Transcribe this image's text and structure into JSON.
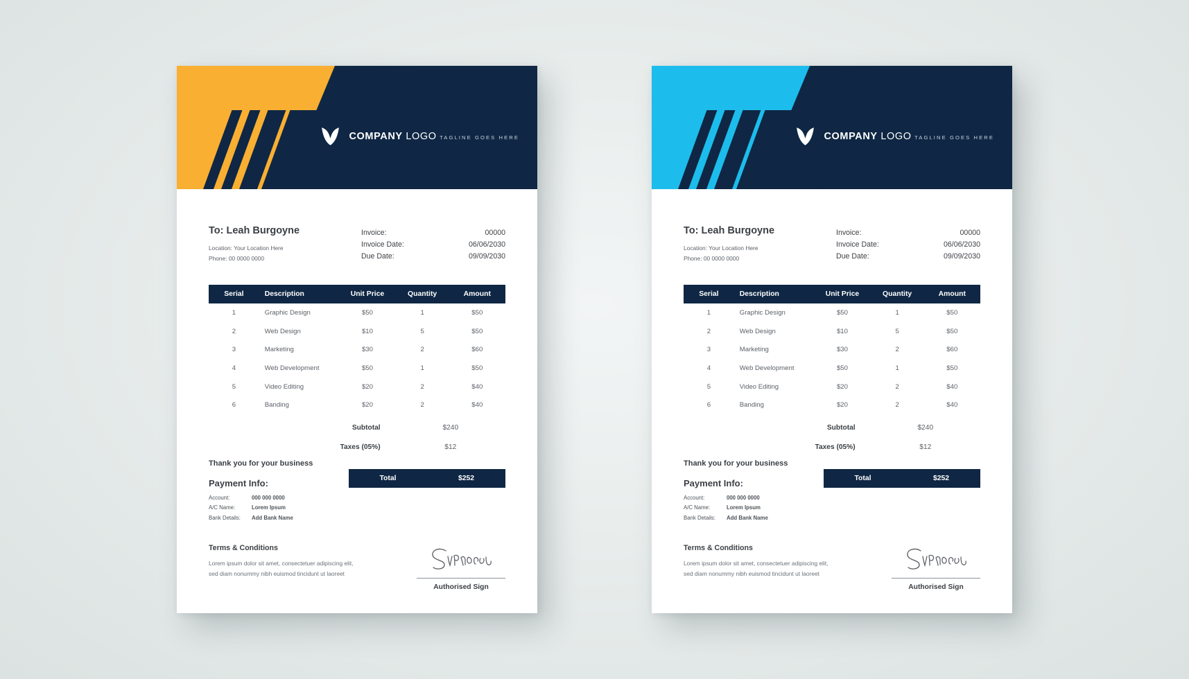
{
  "canvas": {
    "background": "#e8edec"
  },
  "cards": [
    {
      "id": "invoice-orange",
      "accent": "#F9AF32",
      "navy": "#0F2744",
      "logo": {
        "name_bold": "COMPANY",
        "name_light": "LOGO",
        "tagline": "TAGLINE GOES HERE",
        "mark": "butterfly-mark"
      },
      "bill_to": {
        "name": "To: Leah Burgoyne",
        "location": "Location: Your Location Here",
        "phone": "Phone: 00 0000 0000"
      },
      "meta": [
        {
          "label": "Invoice:",
          "value": "00000"
        },
        {
          "label": "Invoice Date:",
          "value": "06/06/2030"
        },
        {
          "label": "Due Date:",
          "value": "09/09/2030"
        }
      ],
      "table": {
        "columns": [
          "Serial",
          "Description",
          "Unit Price",
          "Quantity",
          "Amount"
        ],
        "rows": [
          [
            "1",
            "Graphic Design",
            "$50",
            "1",
            "$50"
          ],
          [
            "2",
            "Web Design",
            "$10",
            "5",
            "$50"
          ],
          [
            "3",
            "Marketing",
            "$30",
            "2",
            "$60"
          ],
          [
            "4",
            "Web Development",
            "$50",
            "1",
            "$50"
          ],
          [
            "5",
            "Video Editing",
            "$20",
            "2",
            "$40"
          ],
          [
            "6",
            "Banding",
            "$20",
            "2",
            "$40"
          ]
        ]
      },
      "summary": [
        {
          "label": "Subtotal",
          "value": "$240"
        },
        {
          "label": "Taxes (05%)",
          "value": "$12"
        }
      ],
      "total": {
        "label": "Total",
        "value": "$252"
      },
      "thanks": "Thank you for your business",
      "payment": {
        "title": "Payment Info:",
        "rows": [
          {
            "key": "Account:",
            "value": "000 000 0000"
          },
          {
            "key": "A/C Name:",
            "value": "Lorem Ipsum"
          },
          {
            "key": "Bank Details:",
            "value": "Add Bank Name"
          }
        ]
      },
      "terms": {
        "title": "Terms & Conditions",
        "text": "Lorem ipsum dolor sit amet, consectetuer adipiscing elit, sed diam nonummy nibh euismod tincidunt ut laoreet"
      },
      "signature": {
        "script": "Signature",
        "label": "Authorised Sign"
      }
    },
    {
      "id": "invoice-cyan",
      "accent": "#1CBDEC",
      "navy": "#0F2744",
      "logo": {
        "name_bold": "COMPANY",
        "name_light": "LOGO",
        "tagline": "TAGLINE GOES HERE",
        "mark": "butterfly-mark"
      },
      "bill_to": {
        "name": "To: Leah Burgoyne",
        "location": "Location: Your Location Here",
        "phone": "Phone: 00 0000 0000"
      },
      "meta": [
        {
          "label": "Invoice:",
          "value": "00000"
        },
        {
          "label": "Invoice Date:",
          "value": "06/06/2030"
        },
        {
          "label": "Due Date:",
          "value": "09/09/2030"
        }
      ],
      "table": {
        "columns": [
          "Serial",
          "Description",
          "Unit Price",
          "Quantity",
          "Amount"
        ],
        "rows": [
          [
            "1",
            "Graphic Design",
            "$50",
            "1",
            "$50"
          ],
          [
            "2",
            "Web Design",
            "$10",
            "5",
            "$50"
          ],
          [
            "3",
            "Marketing",
            "$30",
            "2",
            "$60"
          ],
          [
            "4",
            "Web Development",
            "$50",
            "1",
            "$50"
          ],
          [
            "5",
            "Video Editing",
            "$20",
            "2",
            "$40"
          ],
          [
            "6",
            "Banding",
            "$20",
            "2",
            "$40"
          ]
        ]
      },
      "summary": [
        {
          "label": "Subtotal",
          "value": "$240"
        },
        {
          "label": "Taxes (05%)",
          "value": "$12"
        }
      ],
      "total": {
        "label": "Total",
        "value": "$252"
      },
      "thanks": "Thank you for your business",
      "payment": {
        "title": "Payment Info:",
        "rows": [
          {
            "key": "Account:",
            "value": "000 000 0000"
          },
          {
            "key": "A/C Name:",
            "value": "Lorem Ipsum"
          },
          {
            "key": "Bank Details:",
            "value": "Add Bank Name"
          }
        ]
      },
      "terms": {
        "title": "Terms & Conditions",
        "text": "Lorem ipsum dolor sit amet, consectetuer adipiscing elit, sed diam nonummy nibh euismod tincidunt ut laoreet"
      },
      "signature": {
        "script": "Signature",
        "label": "Authorised Sign"
      }
    }
  ]
}
